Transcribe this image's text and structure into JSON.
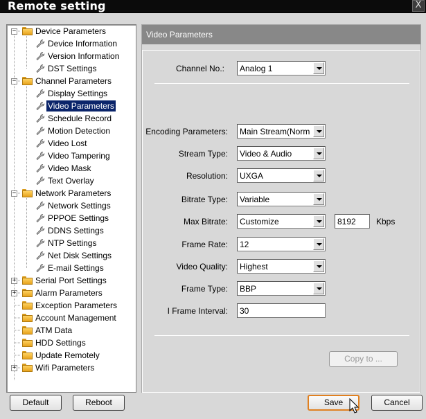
{
  "window": {
    "title": "Remote setting",
    "close_label": "X"
  },
  "tree": {
    "groups": [
      {
        "label": "Device Parameters",
        "expander": "−",
        "children": [
          "Device Information",
          "Version Information",
          "DST Settings"
        ]
      },
      {
        "label": "Channel Parameters",
        "expander": "−",
        "children": [
          "Display Settings",
          "Video Parameters",
          "Schedule Record",
          "Motion Detection",
          "Video Lost",
          "Video Tampering",
          "Video Mask",
          "Text Overlay"
        ]
      },
      {
        "label": "Network Parameters",
        "expander": "−",
        "children": [
          "Network Settings",
          "PPPOE Settings",
          "DDNS Settings",
          "NTP Settings",
          "Net Disk Settings",
          "E-mail Settings"
        ]
      },
      {
        "label": "Serial Port Settings",
        "expander": "+"
      },
      {
        "label": "Alarm Parameters",
        "expander": "+"
      },
      {
        "label": "Exception Parameters"
      },
      {
        "label": "Account Management"
      },
      {
        "label": "ATM Data"
      },
      {
        "label": "HDD Settings"
      },
      {
        "label": "Update Remotely"
      },
      {
        "label": "Wifi Parameters",
        "expander": "+"
      }
    ],
    "selected": "Video Parameters"
  },
  "panel": {
    "title": "Video Parameters",
    "channel": {
      "label": "Channel No.:",
      "value": "Analog 1"
    },
    "encoding": {
      "label": "Encoding Parameters:",
      "value": "Main Stream(Norm"
    },
    "stream_type": {
      "label": "Stream Type:",
      "value": "Video & Audio"
    },
    "resolution": {
      "label": "Resolution:",
      "value": "UXGA"
    },
    "bitrate_type": {
      "label": "Bitrate Type:",
      "value": "Variable"
    },
    "max_bitrate": {
      "label": "Max Bitrate:",
      "value": "Customize",
      "custom_value": "8192",
      "unit": "Kbps"
    },
    "frame_rate": {
      "label": "Frame Rate:",
      "value": "12"
    },
    "video_quality": {
      "label": "Video Quality:",
      "value": "Highest"
    },
    "frame_type": {
      "label": "Frame Type:",
      "value": "BBP"
    },
    "i_frame": {
      "label": "I Frame Interval:",
      "value": "30"
    },
    "copy_label": "Copy to ..."
  },
  "footer": {
    "default_label": "Default",
    "reboot_label": "Reboot",
    "save_label": "Save",
    "cancel_label": "Cancel"
  },
  "colors": {
    "selection": "#0a246a",
    "header": "#888888",
    "focus_border": "#e08020"
  }
}
